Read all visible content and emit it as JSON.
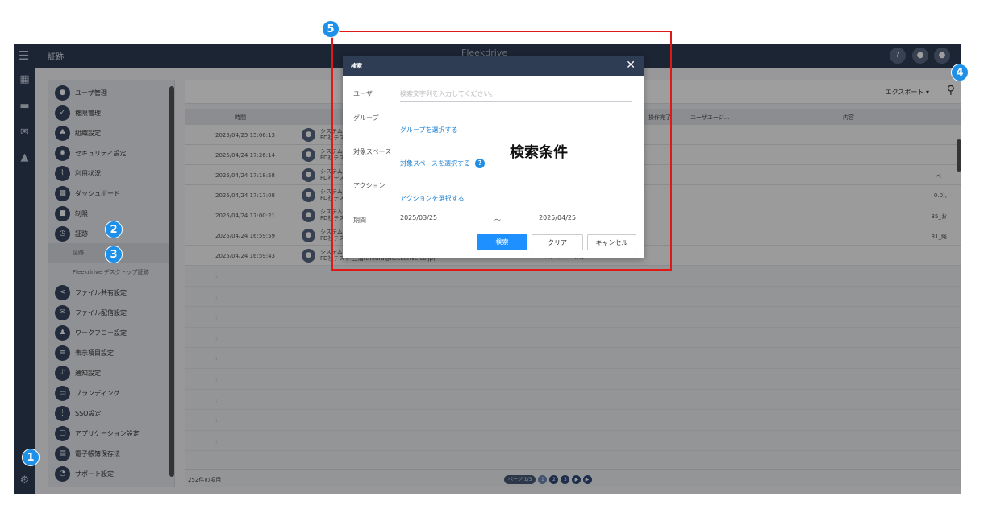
{
  "topbar": {
    "title": "証跡",
    "brand": "Fleekdrive",
    "menu_icon": "hamburger-icon",
    "help": "?",
    "bell": "●",
    "user": "●"
  },
  "rail": {
    "icons": [
      "▦",
      "▬",
      "✉",
      "▲",
      "⚙"
    ]
  },
  "nav": {
    "items": [
      {
        "label": "ユーザ管理",
        "icon": "user-icon",
        "glyph": "●"
      },
      {
        "label": "権限管理",
        "icon": "shield-icon",
        "glyph": "✓"
      },
      {
        "label": "組織設定",
        "icon": "org-icon",
        "glyph": "♣"
      },
      {
        "label": "セキュリティ設定",
        "icon": "lock-icon",
        "glyph": "◉"
      },
      {
        "label": "利用状況",
        "icon": "chart-icon",
        "glyph": "⌇"
      },
      {
        "label": "ダッシュボード",
        "icon": "dashboard-icon",
        "glyph": "▦"
      },
      {
        "label": "制限",
        "icon": "limit-icon",
        "glyph": "■"
      },
      {
        "label": "証跡",
        "icon": "clock-icon",
        "glyph": "◷"
      }
    ],
    "sub_items": [
      "証跡",
      "Fleekdrive デスクトップ証跡"
    ],
    "items2": [
      {
        "label": "ファイル共有設定",
        "icon": "share-icon",
        "glyph": "<"
      },
      {
        "label": "ファイル配信設定",
        "icon": "mail-icon",
        "glyph": "✉"
      },
      {
        "label": "ワークフロー設定",
        "icon": "workflow-icon",
        "glyph": "♟"
      },
      {
        "label": "表示項目設定",
        "icon": "list-icon",
        "glyph": "≡"
      },
      {
        "label": "通知設定",
        "icon": "bell-icon",
        "glyph": "♪"
      },
      {
        "label": "ブランディング",
        "icon": "brand-icon",
        "glyph": "▭"
      },
      {
        "label": "SSO設定",
        "icon": "sso-icon",
        "glyph": "⋮"
      },
      {
        "label": "アプリケーション設定",
        "icon": "app-icon",
        "glyph": "▢"
      },
      {
        "label": "電子帳簿保存法",
        "icon": "book-icon",
        "glyph": "▤"
      },
      {
        "label": "サポート設定",
        "icon": "support-icon",
        "glyph": "◔"
      }
    ]
  },
  "toolbar": {
    "export": "エクスポート ▾",
    "search_icon": "⚲"
  },
  "table": {
    "headers": [
      "時間",
      "操作完了",
      "ユーザエージ...",
      "内容"
    ],
    "rows": [
      {
        "time": "2025/04/25 15:06:13",
        "who1": "システム管",
        "who2": "FD社テスト",
        "extra": ""
      },
      {
        "time": "2025/04/24 17:26:14",
        "who1": "システム管",
        "who2": "FD社テスト",
        "extra": ""
      },
      {
        "time": "2025/04/24 17:18:58",
        "who1": "システム管",
        "who2": "FD社テスト",
        "extra": "ペー"
      },
      {
        "time": "2025/04/24 17:17:08",
        "who1": "システム管",
        "who2": "FD社テスト",
        "extra": "0.0),"
      },
      {
        "time": "2025/04/24 17:00:21",
        "who1": "システム管",
        "who2": "FD社テスト",
        "extra": "35_お"
      },
      {
        "time": "2025/04/24 16:59:59",
        "who1": "システム管",
        "who2": "FD社テスト",
        "extra": "31_経"
      },
      {
        "time": "2025/04/24 16:59:43",
        "who1": "システム管",
        "who2": "FD社テスト 三浦(tmiura@fleekdrive.co.jp)",
        "extra": "ログイン　成功　12"
      }
    ],
    "empty_marker": ":",
    "count": "252件の項目",
    "page_pill": "ページ 1/3",
    "pages": [
      "1",
      "2",
      "3",
      "▶",
      "▶|"
    ]
  },
  "modal": {
    "title": "検索",
    "close": "✕",
    "user_label": "ユーザ",
    "user_placeholder": "検索文字列を入力してください。",
    "group_label": "グループ",
    "group_link": "グループを選択する",
    "space_label": "対象スペース",
    "space_link": "対象スペースを選択する",
    "help": "?",
    "action_label": "アクション",
    "action_link": "アクションを選択する",
    "period_label": "期間",
    "date_from": "2025/03/25",
    "tilde": "～",
    "date_to": "2025/04/25",
    "search_btn": "検索",
    "clear_btn": "クリア",
    "cancel_btn": "キャンセル"
  },
  "annotation": {
    "label": "検索条件",
    "badges": [
      "1",
      "2",
      "3",
      "4",
      "5"
    ]
  }
}
